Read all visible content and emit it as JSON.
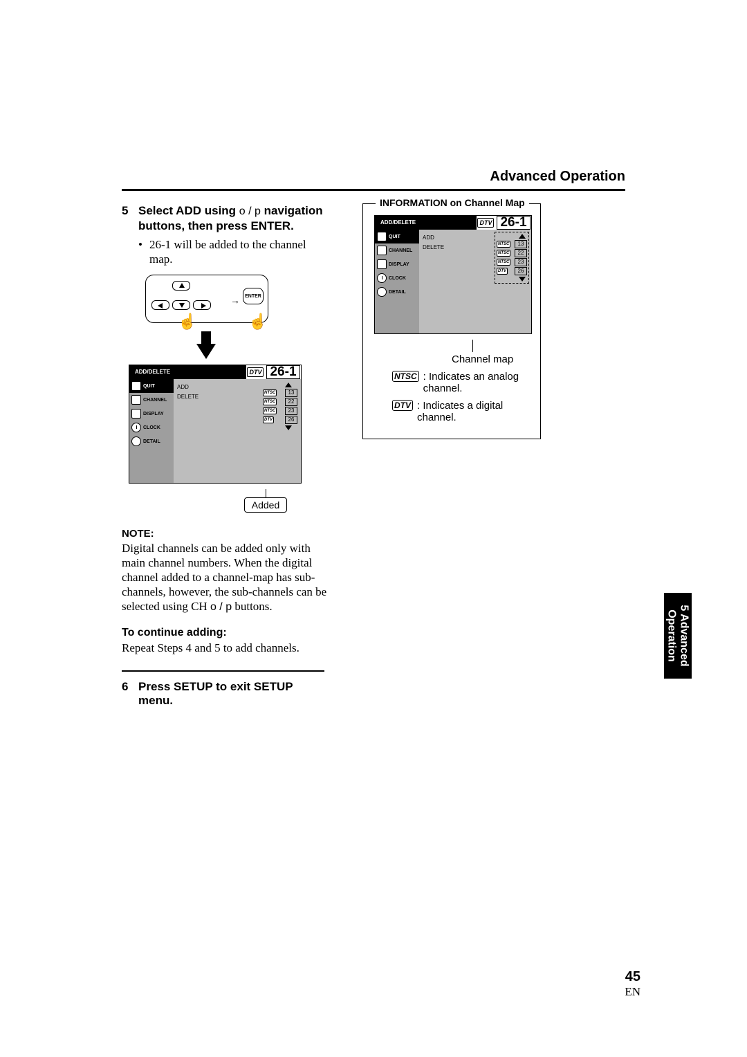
{
  "header_title": "Advanced Operation",
  "step5": {
    "number": "5",
    "text_prefix": "Select ADD using ",
    "nav_symbols": "o / p",
    "text_mid": " navigation buttons, then press ENTER.",
    "bullet": "26-1 will be added to the channel map."
  },
  "remote": {
    "enter_label": "ENTER",
    "arrow_right": "→"
  },
  "osd1": {
    "header_tab": "ADD/DELETE",
    "channel_badge": "DTV",
    "channel_number": "26-1",
    "sidebar": [
      "QUIT",
      "CHANNEL",
      "DISPLAY",
      "CLOCK",
      "DETAIL"
    ],
    "menu_items": [
      "ADD",
      "DELETE"
    ],
    "channels": [
      {
        "type": "NTSC",
        "num": "13"
      },
      {
        "type": "NTSC",
        "num": "22"
      },
      {
        "type": "NTSC",
        "num": "23"
      },
      {
        "type": "DTV",
        "num": "26"
      }
    ],
    "added_label": "Added"
  },
  "note": {
    "label": "NOTE:",
    "text_a": "Digital channels can be added only with main channel numbers. When the digital channel added to a channel-map has sub-channels, however, the sub-channels can be selected using CH ",
    "text_b": " buttons."
  },
  "continue_adding": {
    "head": "To continue adding:",
    "body": "Repeat Steps 4 and 5  to add channels."
  },
  "step6": {
    "number": "6",
    "text": "Press SETUP to exit SETUP menu."
  },
  "info_box": {
    "title": "INFORMATION on Channel Map",
    "channel_map_label": "Channel map",
    "ntsc_label": "NTSC",
    "ntsc_text": ": Indicates an analog channel.",
    "dtv_label": "DTV",
    "dtv_text": ": Indicates a digital channel."
  },
  "side_tab": {
    "line1": "5 Advanced",
    "line2": "Operation"
  },
  "page_number": "45",
  "page_lang": "EN"
}
